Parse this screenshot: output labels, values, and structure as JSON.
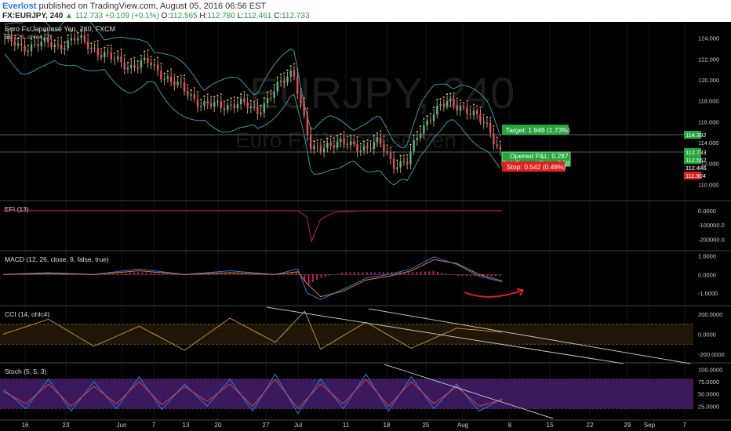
{
  "header": {
    "author": "Everlost",
    "published": "published on TradingView.com, August 05, 2016 06:56 EST",
    "symbol": "FX:EURJPY, 240",
    "change": "▲ 112.733 +0.109 (+0.1%)",
    "open_label": "O:",
    "open": "112.565",
    "high_label": "H:",
    "high": "112.780",
    "low_label": "L:",
    "low": "112.461",
    "close_label": "C:",
    "close": "112.733"
  },
  "price_pane": {
    "title": "Euro Fx/Japanese Yen, 240, FXCM",
    "indicator": "BB (20, ohlc4, 2)",
    "watermark_symbol": "EURJPY, 240",
    "watermark_name": "Euro Fx/Japanese Yen"
  },
  "trade_box": {
    "target_label": "Target: 1.946 (1.73%)",
    "pnl_label": "Opened P&L: 0.287",
    "risk_label": "Risk/Reward Ratio: 3.59",
    "stop_label": "Stop: 0.542 (0.48%)"
  },
  "price_badges": [
    "114.392",
    "112.733",
    "112.552",
    "112.446",
    "111.904"
  ],
  "panes": {
    "efi": {
      "title": "EFI (13)"
    },
    "macd": {
      "title": "MACD (12, 26, close, 9, false, true)"
    },
    "cci": {
      "title": "CCI (14, ohlc4)"
    },
    "stoch": {
      "title": "Stoch (5, 5, 3)"
    }
  },
  "time_axis": [
    "16",
    "23",
    "Jun",
    "7",
    "13",
    "20",
    "27",
    "Jul",
    "11",
    "18",
    "25",
    "Aug",
    "8",
    "15",
    "22",
    "29",
    "Sep",
    "7"
  ],
  "colors": {
    "up_candle": "#53b987",
    "down_candle": "#eb4d5c",
    "bb_band": "#3a9a9a",
    "macd_line": "#2a7ae2",
    "macd_signal": "#e07a30",
    "macd_hist": "#c21c5a",
    "cci_line": "#b8922a",
    "stoch_k": "#2a7ae2",
    "stoch_d": "#e04040",
    "stoch_band": "#3a1a5c",
    "target_green": "#26a63c",
    "stop_red": "#e01f1f",
    "arrow_red": "#e01f1f"
  },
  "chart_data": [
    {
      "type": "candlestick",
      "title": "Euro Fx/Japanese Yen, 240, FXCM",
      "y_ticks": [
        124.0,
        122.0,
        120.0,
        118.0,
        116.0,
        114.0,
        112.0,
        110.0
      ],
      "ylim": [
        108.6,
        125.4
      ],
      "x": [
        0,
        8,
        16,
        24,
        32,
        40,
        48,
        56,
        64,
        72,
        80,
        88,
        96,
        104,
        112,
        120,
        128,
        136,
        144,
        152,
        160,
        166,
        172,
        178,
        184,
        190,
        196,
        202,
        208,
        214,
        220
      ],
      "close": [
        124.0,
        123.0,
        123.6,
        123.2,
        124.0,
        123.0,
        122.0,
        121.3,
        121.7,
        120.2,
        119.0,
        117.6,
        117.5,
        117.8,
        117.0,
        119.0,
        121.0,
        113.0,
        114.0,
        113.8,
        113.5,
        114.0,
        112.0,
        112.0,
        115.2,
        117.0,
        117.8,
        117.5,
        116.5,
        115.5,
        112.733
      ],
      "last": 112.733
    },
    {
      "type": "line",
      "title": "EFI (13)",
      "y_ticks": [
        0.0,
        -100000.0,
        -200000.0
      ],
      "ylim": [
        -270000,
        60000
      ],
      "x": [
        0,
        80,
        120,
        130,
        134,
        136,
        140,
        146,
        160,
        190,
        220
      ],
      "series": [
        {
          "values": [
            0,
            0,
            0,
            0,
            -45000,
            -215000,
            -60000,
            -10000,
            0,
            0,
            0
          ]
        }
      ]
    },
    {
      "type": "line",
      "title": "MACD (12, 26, close, 9, false, true)",
      "y_ticks": [
        1.0,
        0.0,
        -1.0
      ],
      "ylim": [
        -1.6,
        1.2
      ],
      "x": [
        0,
        20,
        40,
        60,
        80,
        100,
        120,
        130,
        134,
        140,
        150,
        160,
        170,
        180,
        190,
        200,
        210,
        220
      ],
      "series": [
        {
          "values": [
            0.0,
            0.1,
            0.0,
            0.3,
            0.0,
            0.2,
            0.0,
            0.3,
            -1.0,
            -1.35,
            -0.8,
            -0.2,
            0.0,
            0.3,
            0.95,
            0.55,
            -0.1,
            -0.4
          ]
        },
        {
          "values": [
            0.0,
            0.05,
            0.0,
            0.2,
            0.0,
            0.1,
            0.0,
            0.15,
            -0.5,
            -1.2,
            -0.9,
            -0.3,
            -0.1,
            0.2,
            0.8,
            0.6,
            0.0,
            -0.35
          ]
        }
      ]
    },
    {
      "type": "line",
      "title": "CCI (14, ohlc4)",
      "y_ticks": [
        200.0,
        0.0,
        -200.0
      ],
      "ylim": [
        -270,
        270
      ],
      "x": [
        0,
        20,
        40,
        60,
        80,
        100,
        120,
        133,
        140,
        160,
        180,
        200,
        220
      ],
      "series": [
        {
          "values": [
            0,
            150,
            -120,
            80,
            -160,
            160,
            -80,
            230,
            -150,
            120,
            -140,
            60,
            20
          ]
        }
      ]
    },
    {
      "type": "line",
      "title": "Stoch (5, 5, 3)",
      "y_ticks": [
        100.0,
        75.0,
        50.0,
        25.0
      ],
      "ylim": [
        0,
        110
      ],
      "x": [
        0,
        10,
        20,
        30,
        40,
        50,
        60,
        70,
        80,
        90,
        100,
        110,
        120,
        130,
        140,
        150,
        160,
        170,
        180,
        190,
        200,
        210,
        220
      ],
      "series": [
        {
          "values": [
            60,
            20,
            80,
            15,
            75,
            20,
            85,
            18,
            70,
            25,
            80,
            15,
            90,
            10,
            80,
            20,
            90,
            15,
            85,
            20,
            70,
            15,
            40
          ]
        },
        {
          "values": [
            55,
            30,
            70,
            25,
            65,
            30,
            75,
            28,
            65,
            35,
            70,
            25,
            80,
            20,
            70,
            30,
            80,
            25,
            75,
            30,
            65,
            25,
            38
          ]
        }
      ]
    }
  ]
}
